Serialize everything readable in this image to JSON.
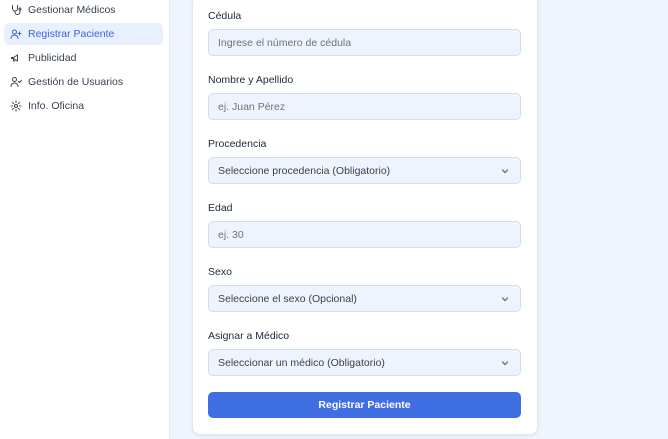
{
  "sidebar": {
    "items": [
      {
        "label": "Gestionar Médicos",
        "icon": "stethoscope-icon",
        "active": false
      },
      {
        "label": "Registrar Paciente",
        "icon": "user-plus-icon",
        "active": true
      },
      {
        "label": "Publicidad",
        "icon": "megaphone-icon",
        "active": false
      },
      {
        "label": "Gestión de Usuarios",
        "icon": "users-icon",
        "active": false
      },
      {
        "label": "Info. Oficina",
        "icon": "gear-icon",
        "active": false
      }
    ]
  },
  "form": {
    "cedula": {
      "label": "Cédula",
      "placeholder": "Ingrese el número de cédula",
      "value": ""
    },
    "nombre": {
      "label": "Nombre y Apellido",
      "placeholder": "ej. Juan Pérez",
      "value": ""
    },
    "procedencia": {
      "label": "Procedencia",
      "selected": "Seleccione procedencia (Obligatorio)"
    },
    "edad": {
      "label": "Edad",
      "placeholder": "ej. 30",
      "value": ""
    },
    "sexo": {
      "label": "Sexo",
      "selected": "Seleccione el sexo (Opcional)"
    },
    "medico": {
      "label": "Asignar a Médico",
      "selected": "Seleccionar un médico (Obligatorio)"
    },
    "submit_label": "Registrar Paciente"
  },
  "colors": {
    "accent": "#3f6ee0",
    "active_bg": "#e8f0fd",
    "active_text": "#3b63d9",
    "field_bg": "#eef4fd",
    "page_bg": "#eff5fe"
  }
}
